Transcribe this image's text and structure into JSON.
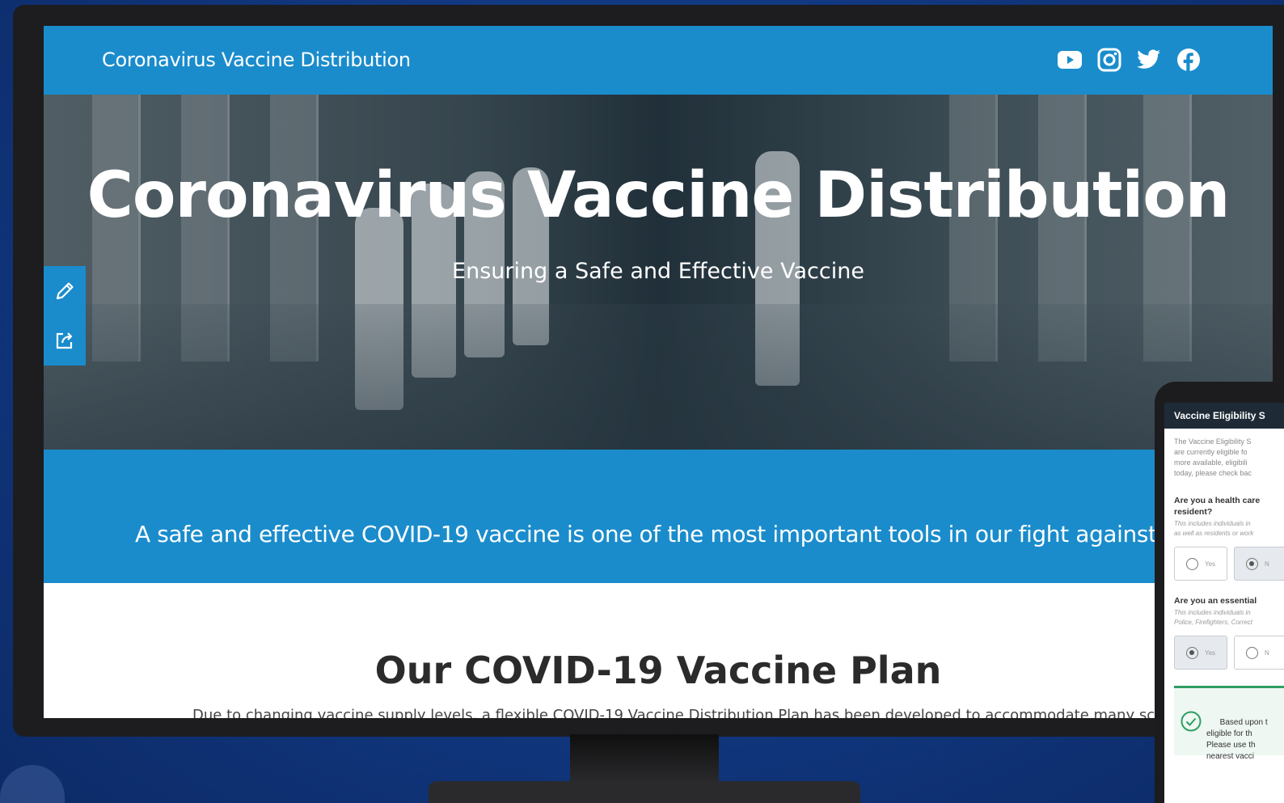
{
  "site": {
    "title": "Coronavirus Vaccine Distribution",
    "social_icons": [
      "youtube-icon",
      "instagram-icon",
      "twitter-icon",
      "facebook-icon"
    ]
  },
  "hero": {
    "title": "Coronavirus Vaccine Distribution",
    "subtitle": "Ensuring a Safe and Effective Vaccine"
  },
  "tools": [
    "pencil-icon",
    "share-icon"
  ],
  "banner": {
    "text": "A safe and effective COVID-19 vaccine is one of the most important tools in our fight against the pandemi"
  },
  "plan": {
    "title": "Our COVID-19 Vaccine Plan",
    "text": "Due to changing vaccine supply levels, a flexible COVID-19 Vaccine Distribution Plan has been developed to accommodate many scenarios"
  },
  "tablet": {
    "header": "Vaccine Eligibility S",
    "intro": "The Vaccine Eligibility S\nare currently eligible fo\nmore available, eligibili\ntoday, please check bac",
    "q1": "Are you a health care\nresident?",
    "q1_note": "This includes individuals in\nas well as residents or work",
    "q1_yes": "Yes",
    "q1_no": "N",
    "q2": "Are you an essential",
    "q2_note": "This includes individuals in\nPolice, Firefighters, Correct",
    "q2_yes": "Yes",
    "q2_no": "N",
    "result": "Based upon t\neligible for th\nPlease use th\nnearest vacci"
  },
  "colors": {
    "brand_blue": "#1a8ccc",
    "background": "#123a85",
    "success": "#2f9e63"
  }
}
